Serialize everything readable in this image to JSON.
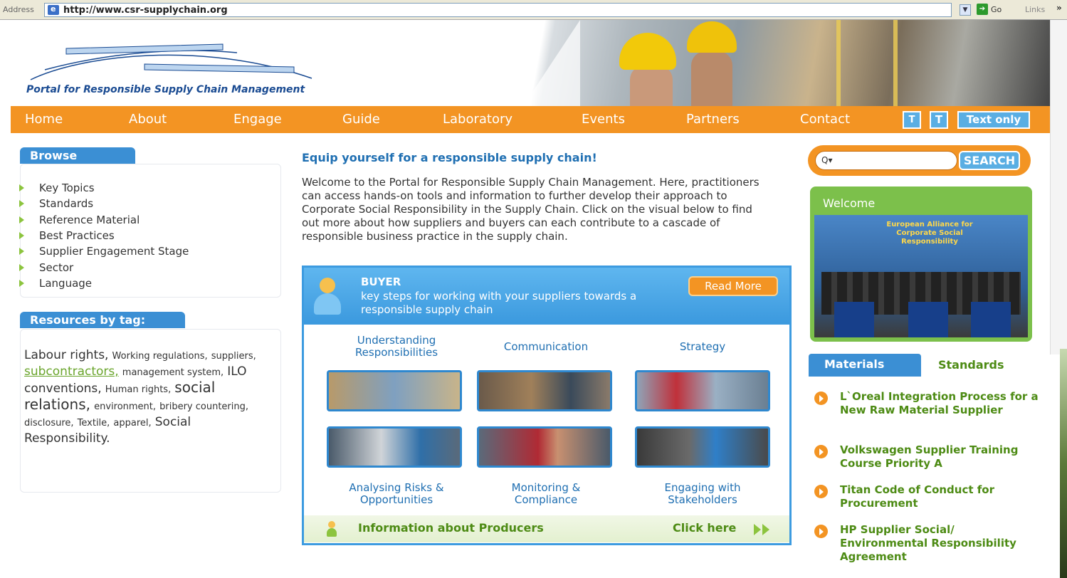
{
  "browser": {
    "address_label": "Address",
    "url": "http://www.csr-supplychain.org",
    "go_label": "Go",
    "links_label": "Links",
    "more_label": "»"
  },
  "site": {
    "logo_text": "Portal for Responsible Supply Chain Management"
  },
  "nav": {
    "items": [
      "Home",
      "About",
      "Engage",
      "Guide",
      "Laboratory",
      "Events",
      "Partners",
      "Contact"
    ],
    "text_size_small": "T",
    "text_size_large": "T",
    "text_only": "Text only"
  },
  "browse": {
    "title": "Browse",
    "items": [
      "Key Topics",
      "Standards",
      "Reference Material",
      "Best Practices",
      "Supplier Engagement Stage",
      "Sector",
      "Language"
    ]
  },
  "resources": {
    "title": "Resources by tag:",
    "tags": [
      {
        "text": "Labour rights,",
        "size": "large"
      },
      {
        "text": "Working regulations,",
        "size": "small"
      },
      {
        "text": "suppliers,",
        "size": "small"
      },
      {
        "text": "subcontractors,",
        "size": "large",
        "link": true
      },
      {
        "text": "management system,",
        "size": "small"
      },
      {
        "text": "ILO conventions,",
        "size": "large"
      },
      {
        "text": "Human rights,",
        "size": "small"
      },
      {
        "text": "social relations,",
        "size": "xlarge"
      },
      {
        "text": "environment,",
        "size": "small"
      },
      {
        "text": "bribery countering,",
        "size": "small"
      },
      {
        "text": "disclosure,",
        "size": "small"
      },
      {
        "text": "Textile,",
        "size": "small"
      },
      {
        "text": "apparel,",
        "size": "small"
      },
      {
        "text": "Social Responsibility.",
        "size": "large"
      }
    ]
  },
  "main": {
    "heading": "Equip yourself for a responsible supply chain!",
    "intro": "Welcome to the Portal for Responsible Supply Chain Management. Here, practitioners can access hands-on tools and information to further develop their approach to Corporate Social Responsibility in the Supply Chain. Click on the visual below to find out more about how suppliers and buyers can each contribute to a cascade of responsible business practice in the supply chain."
  },
  "buyer": {
    "title": "BUYER",
    "subtitle": "key steps for working with your suppliers towards a responsible supply chain",
    "read_more": "Read More",
    "steps_top": [
      "Understanding Responsibilities",
      "Communication",
      "Strategy"
    ],
    "steps_bottom": [
      "Analysing Risks & Opportunities",
      "Monitoring & Compliance",
      "Engaging with Stakeholders"
    ],
    "footer_label": "Information about Producers",
    "footer_link": "Click here"
  },
  "sidebar": {
    "search_placeholder": "Q▾",
    "search_button": "SEARCH",
    "welcome_title": "Welcome",
    "welcome_sign": "European Alliance for Corporate Social Responsibility",
    "tabs": [
      "Materials",
      "Standards"
    ],
    "materials": [
      "L`Oreal Integration Process for a New Raw Material Supplier",
      "Volkswagen Supplier Training Course Priority A",
      "Titan Code of Conduct for Procurement",
      "HP Supplier Social/ Environmental Responsibility Agreement"
    ]
  },
  "colors": {
    "orange": "#f39423",
    "blue": "#3b8fd4",
    "green": "#7cc04b",
    "link_green": "#4d8b14",
    "heading_blue": "#1f6fb2"
  }
}
